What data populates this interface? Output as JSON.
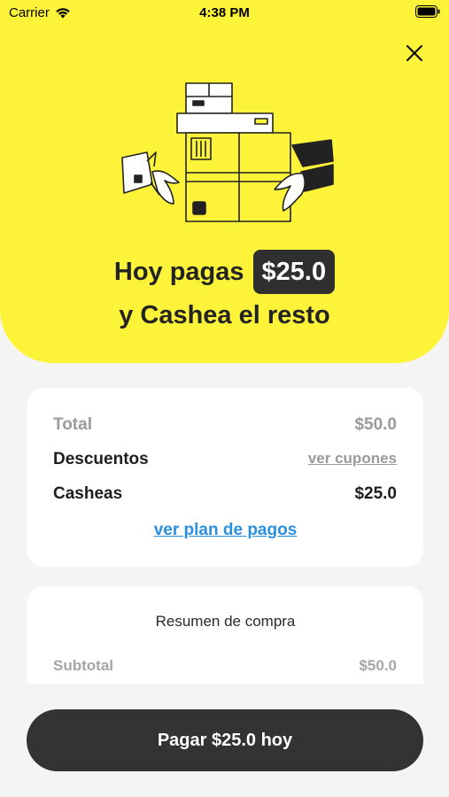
{
  "status_bar": {
    "carrier": "Carrier",
    "time": "4:38 PM"
  },
  "hero": {
    "pay_prefix": "Hoy pagas",
    "pay_amount": "$25.0",
    "rest_text": "y Cashea el resto",
    "background_color": "#fdf43a"
  },
  "totals_card": {
    "total_label": "Total",
    "total_value": "$50.0",
    "discounts_label": "Descuentos",
    "coupons_link": "ver cupones",
    "casheas_label": "Casheas",
    "casheas_value": "$25.0",
    "plan_link": "ver plan de pagos",
    "link_color": "#2b8fe0"
  },
  "summary_card": {
    "title": "Resumen de compra",
    "subtotal_label": "Subtotal",
    "subtotal_value": "$50.0"
  },
  "pay_button": {
    "label": "Pagar $25.0 hoy",
    "color": "#333334"
  },
  "icons": [
    "wifi-icon",
    "battery-icon",
    "close-icon",
    "delivery-box-illustration"
  ]
}
